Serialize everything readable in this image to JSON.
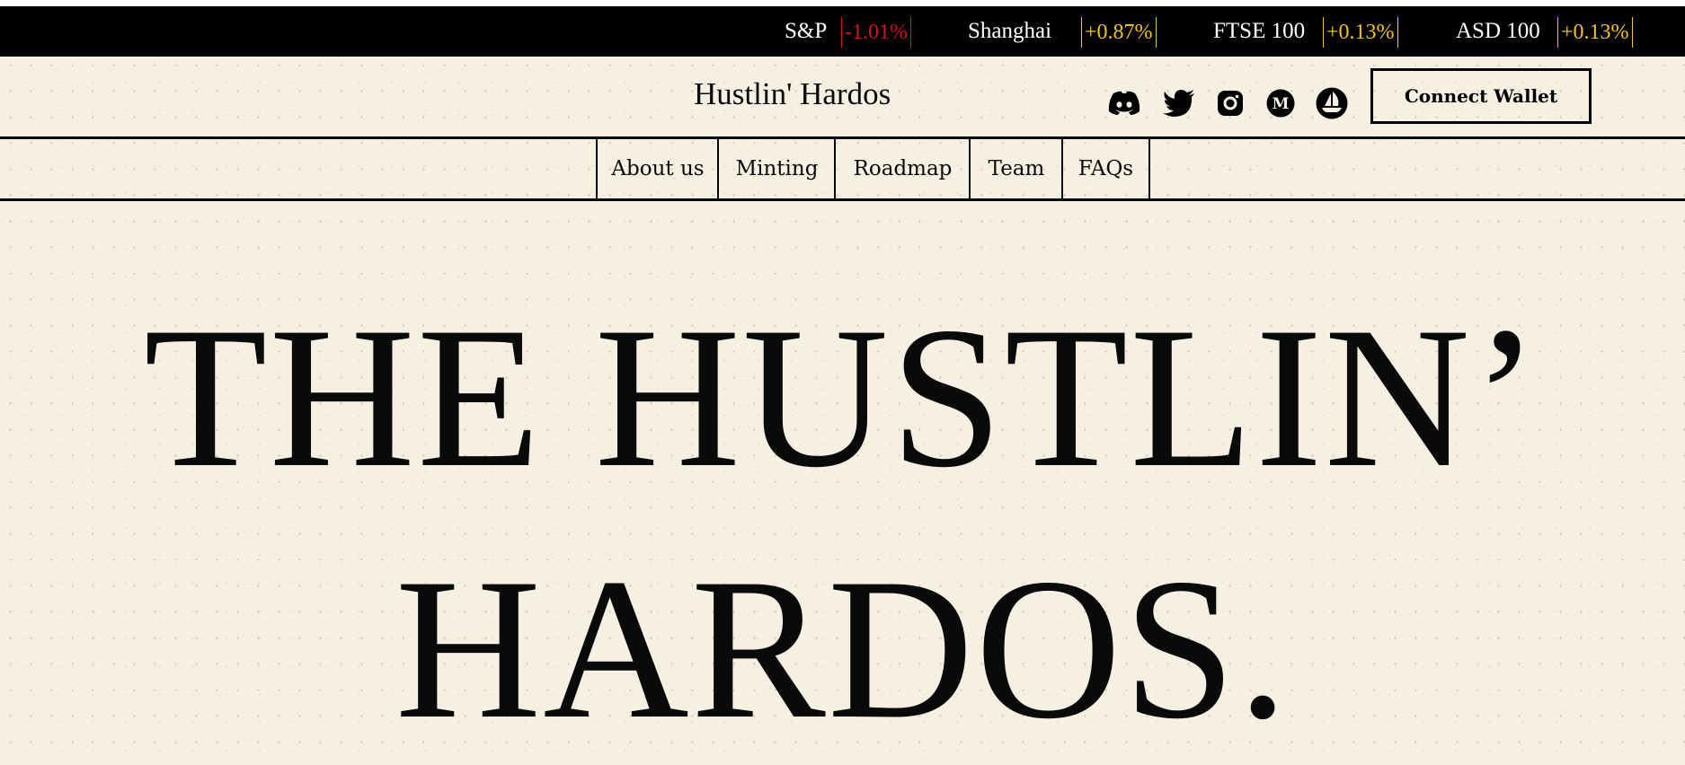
{
  "ticker": {
    "items": [
      {
        "name": "S&P",
        "change": "-1.01%",
        "direction": "down"
      },
      {
        "name": "Shanghai",
        "change": "+0.87%",
        "direction": "up"
      },
      {
        "name": "FTSE 100",
        "change": "+0.13%",
        "direction": "up"
      },
      {
        "name": "ASD 100",
        "change": "+0.13%",
        "direction": "up"
      }
    ],
    "colors": {
      "down": "#d4101a",
      "up": "#f2c21b",
      "background": "#000000",
      "text": "#ffffff"
    }
  },
  "header": {
    "brand": "Hustlin' Hardos",
    "social_icons": [
      "discord-icon",
      "twitter-icon",
      "instagram-icon",
      "medium-icon",
      "opensea-icon"
    ],
    "connect_label": "Connect Wallet"
  },
  "nav": {
    "items": [
      "About us",
      "Minting",
      "Roadmap",
      "Team",
      "FAQs"
    ]
  },
  "hero": {
    "line1": "THE HUSTLIN’",
    "line2": "HARDOS."
  },
  "colors": {
    "background": "#f5f0e2",
    "ink": "#0a0a0a"
  }
}
